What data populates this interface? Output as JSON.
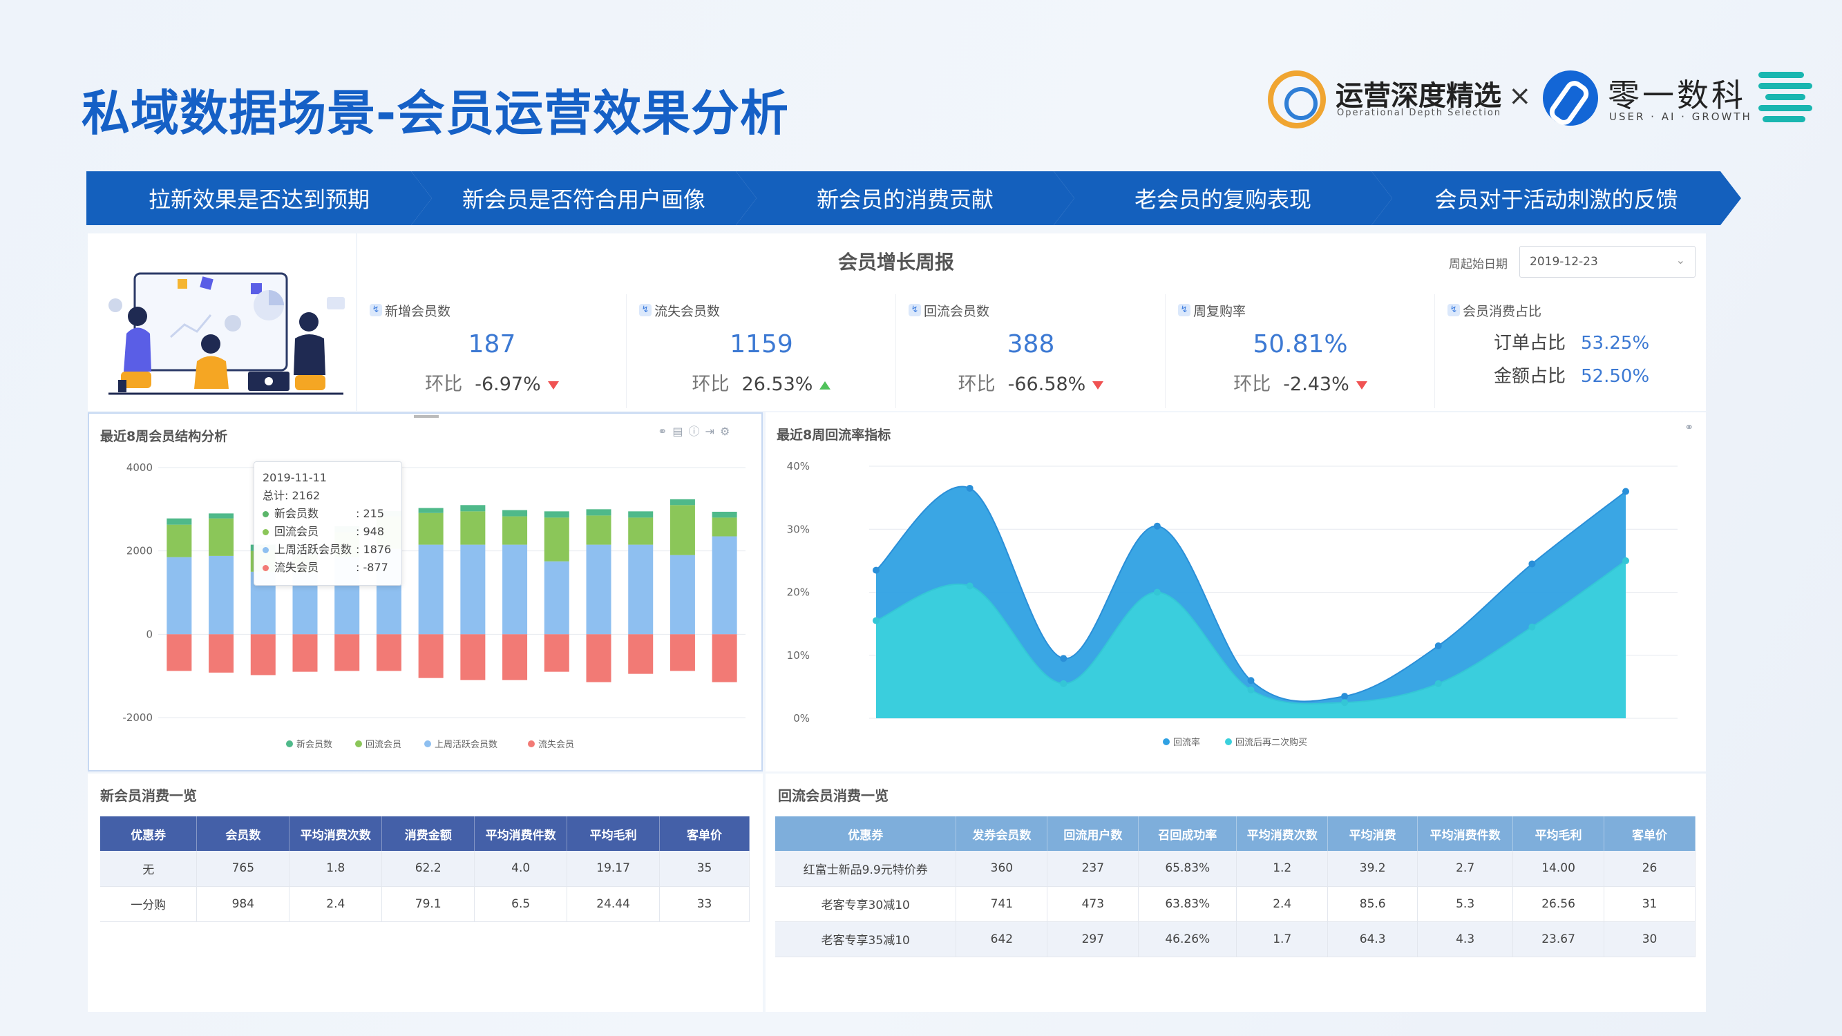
{
  "title": "私域数据场景-会员运营效果分析",
  "logos": {
    "brand1": "运营深度精选",
    "brand1_sub": "Operational Depth Selection",
    "times": "×",
    "brand2": "零一数科",
    "brand2_sub": "USER · AI · GROWTH"
  },
  "steps": [
    "拉新效果是否达到预期",
    "新会员是否符合用户画像",
    "新会员的消费贡献",
    "老会员的复购表现",
    "会员对于活动刺激的反馈"
  ],
  "colors": {
    "accent": "#1460bd",
    "title": "#1560c6",
    "kpi_value": "#3c79d3",
    "down": "#f05252",
    "up": "#4fc25a"
  },
  "report": {
    "title": "会员增长周报",
    "date_label": "周起始日期",
    "date_value": "2019-12-23",
    "ratio_label": "环比",
    "kpis": [
      {
        "label": "新增会员数",
        "value": "187",
        "ratio": "-6.97%",
        "trend": "down"
      },
      {
        "label": "流失会员数",
        "value": "1159",
        "ratio": "26.53%",
        "trend": "up"
      },
      {
        "label": "回流会员数",
        "value": "388",
        "ratio": "-66.58%",
        "trend": "down"
      },
      {
        "label": "周复购率",
        "value": "50.81%",
        "ratio": "-2.43%",
        "trend": "down"
      }
    ],
    "share": {
      "label": "会员消费占比",
      "order_label": "订单占比",
      "order_value": "53.25%",
      "amount_label": "金额占比",
      "amount_value": "52.50%"
    }
  },
  "bar_chart": {
    "title": "最近8周会员结构分析"
  },
  "area_chart": {
    "title": "最近8周回流率指标"
  },
  "tooltip": {
    "date": "2019-11-11",
    "total": "总计: 2162",
    "rows": [
      {
        "name": "新会员数",
        "value": ": 215",
        "color": "#5bb66a"
      },
      {
        "name": "回流会员",
        "value": ": 948",
        "color": "#8bc659"
      },
      {
        "name": "上周活跃会员数",
        "value": ": 1876",
        "color": "#8ebff0"
      },
      {
        "name": "流失会员",
        "value": ": -877",
        "color": "#f27a75"
      }
    ]
  },
  "chart_data": [
    {
      "type": "bar",
      "title": "最近8周会员结构分析",
      "stacked": true,
      "categories": [
        "",
        "",
        "",
        "",
        "",
        "",
        "",
        "",
        "",
        "",
        "",
        "",
        "",
        ""
      ],
      "ylim": [
        -2000,
        4000
      ],
      "yticks": [
        "4000",
        "2000",
        "0",
        "-2000"
      ],
      "series": [
        {
          "name": "新会员数",
          "color": "#4fb98a",
          "values": [
            150,
            120,
            150,
            130,
            140,
            130,
            120,
            150,
            150,
            150,
            150,
            150,
            140,
            140
          ]
        },
        {
          "name": "回流会员",
          "color": "#8bc659",
          "values": [
            780,
            900,
            500,
            400,
            600,
            780,
            760,
            800,
            680,
            1050,
            700,
            650,
            1200,
            450
          ]
        },
        {
          "name": "上周活跃会员数",
          "color": "#8ebff0",
          "values": [
            1850,
            1880,
            1500,
            1500,
            1850,
            2050,
            2150,
            2150,
            2150,
            1750,
            2150,
            2150,
            1900,
            2350
          ]
        },
        {
          "name": "流失会员",
          "color": "#f27a75",
          "values": [
            -880,
            -920,
            -980,
            -900,
            -880,
            -880,
            -1050,
            -1100,
            -1100,
            -900,
            -1150,
            -950,
            -880,
            -1150
          ]
        }
      ],
      "legend": "bottom-center",
      "grid": true
    },
    {
      "type": "area",
      "title": "最近8周回流率指标",
      "x": [
        1,
        2,
        3,
        4,
        5,
        6,
        7,
        8,
        9
      ],
      "ylim": [
        0,
        40
      ],
      "yticks": [
        "40%",
        "30%",
        "20%",
        "10%",
        "0%"
      ],
      "series": [
        {
          "name": "回流率",
          "color": "#2fa1e3",
          "values": [
            23.5,
            36.5,
            9.5,
            30.5,
            6.0,
            3.5,
            11.5,
            24.5,
            36.0
          ]
        },
        {
          "name": "回流后再二次购买",
          "color": "#3ad0dc",
          "values": [
            15.5,
            21.0,
            5.5,
            20.0,
            4.5,
            2.5,
            5.5,
            14.5,
            25.0
          ]
        }
      ],
      "legend": "bottom-center",
      "grid": true
    }
  ],
  "table1": {
    "title": "新会员消费一览",
    "headers": [
      "优惠券",
      "会员数",
      "平均消费次数",
      "消费金额",
      "平均消费件数",
      "平均毛利",
      "客单价"
    ],
    "rows": [
      [
        "无",
        "765",
        "1.8",
        "62.2",
        "4.0",
        "19.17",
        "35"
      ],
      [
        "一分购",
        "984",
        "2.4",
        "79.1",
        "6.5",
        "24.44",
        "33"
      ]
    ]
  },
  "table2": {
    "title": "回流会员消费一览",
    "headers": [
      "优惠券",
      "发券会员数",
      "回流用户数",
      "召回成功率",
      "平均消费次数",
      "平均消费",
      "平均消费件数",
      "平均毛利",
      "客单价"
    ],
    "rows": [
      [
        "红富士新品9.9元特价券",
        "360",
        "237",
        "65.83%",
        "1.2",
        "39.2",
        "2.7",
        "14.00",
        "26"
      ],
      [
        "老客专享30减10",
        "741",
        "473",
        "63.83%",
        "2.4",
        "85.6",
        "5.3",
        "26.56",
        "31"
      ],
      [
        "老客专享35减10",
        "642",
        "297",
        "46.26%",
        "1.7",
        "64.3",
        "4.3",
        "23.67",
        "30"
      ]
    ]
  }
}
